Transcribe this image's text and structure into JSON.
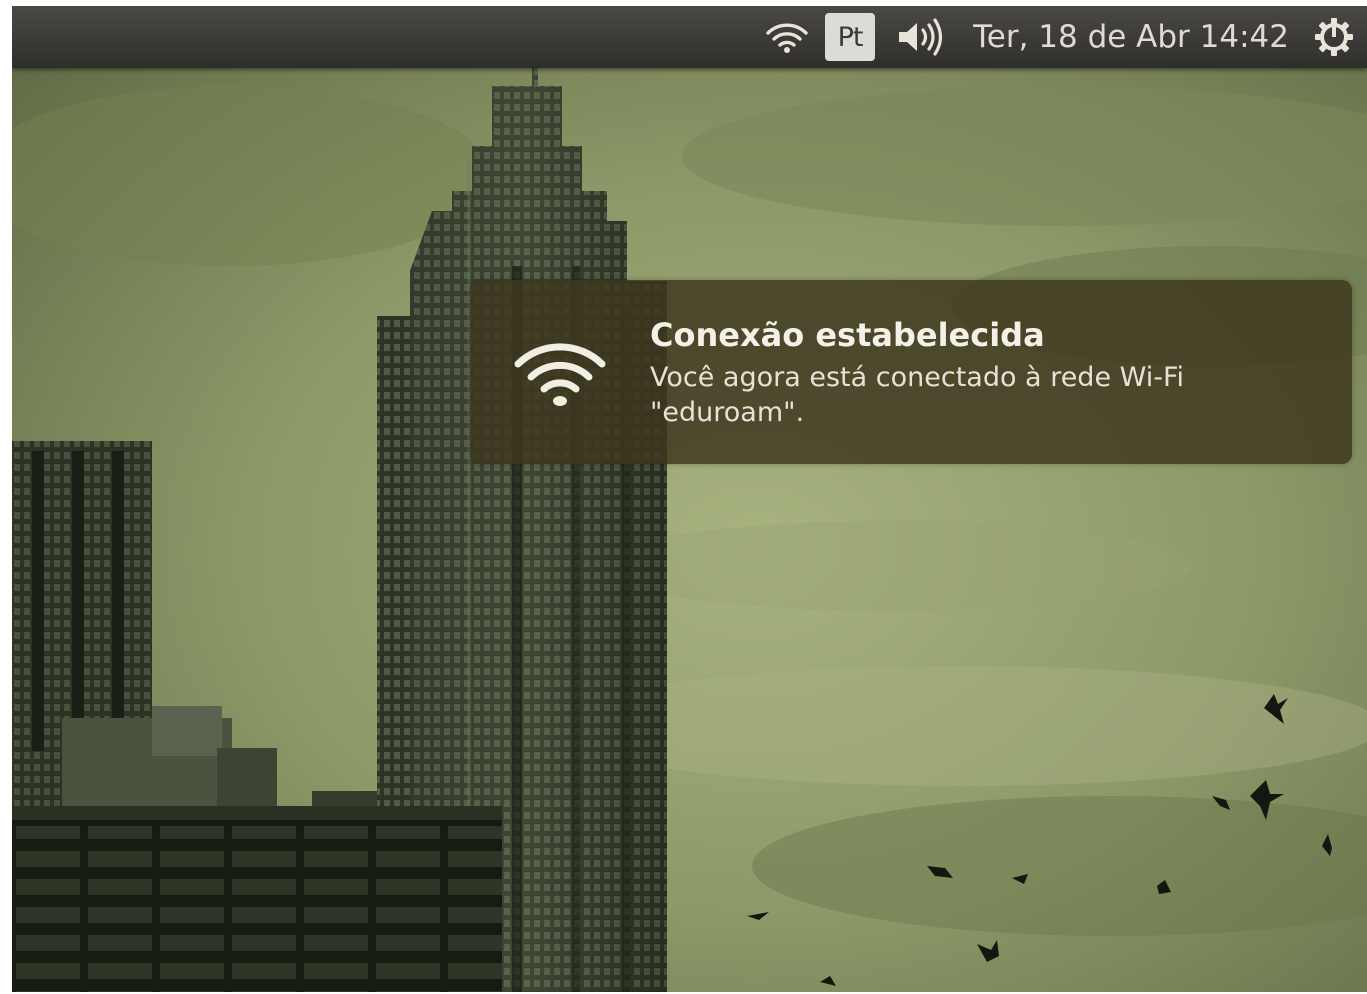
{
  "panel": {
    "network_icon": "wifi-signal-icon",
    "keyboard_layout": "Pt",
    "sound_icon": "speaker-volume-icon",
    "clock": "Ter, 18 de Abr 14:42",
    "session_icon": "gear-power-icon"
  },
  "notification": {
    "icon": "wifi-signal-icon",
    "title": "Conexão estabelecida",
    "body_line1": "Você agora está conectado à rede Wi-Fi",
    "body_line2": "\"eduroam\"."
  },
  "wallpaper": {
    "description_icon": "city-skyline-wallpaper",
    "sky_color": "#8a9566",
    "building_color": "#1f2418"
  }
}
